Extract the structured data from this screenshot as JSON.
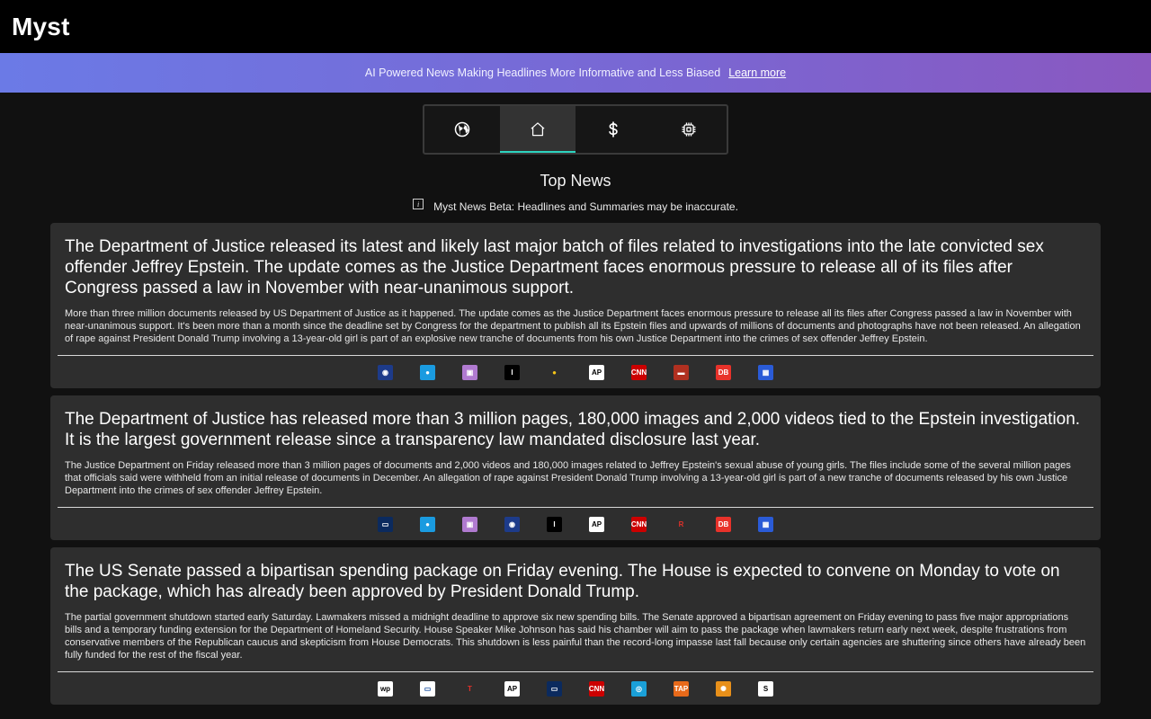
{
  "app": {
    "title": "Myst"
  },
  "banner": {
    "text": "AI Powered News Making Headlines More Informative and Less Biased",
    "link": "Learn more"
  },
  "tabs": [
    {
      "icon": "globe-icon",
      "active": false
    },
    {
      "icon": "home-icon",
      "active": true
    },
    {
      "icon": "dollar-icon",
      "active": false
    },
    {
      "icon": "chip-icon",
      "active": false
    }
  ],
  "section": {
    "title": "Top News",
    "beta_note": "Myst News Beta: Headlines and Summaries may be inaccurate."
  },
  "articles": [
    {
      "headline": "The Department of Justice released its latest and likely last major batch of files related to investigations into the late convicted sex offender Jeffrey Epstein. The update comes as the Justice Department faces enormous pressure to release all of its files after Congress passed a law in November with near-unanimous support.",
      "summary": "More than three million documents released by US Department of Justice as it happened. The update comes as the Justice Department faces enormous pressure to release all its files after Congress passed a law in November with near-unanimous support. It's been more than a month since the deadline set by Congress for the department to publish all its Epstein files and upwards of millions of documents and photographs have not been released. An allegation of rape against President Donald Trump involving a 13-year-old girl is part of an explosive new tranche of documents from his own Justice Department into the crimes of sex offender Jeffrey Epstein.",
      "sources": [
        {
          "name": "source-logo-1",
          "glyph": "◉",
          "bg": "#1d3b8a",
          "fg": "#ffffff"
        },
        {
          "name": "source-logo-2",
          "glyph": "●",
          "bg": "#1a9be0",
          "fg": "#ffffff"
        },
        {
          "name": "source-logo-3",
          "glyph": "▣",
          "bg": "#b07ad0",
          "fg": "#ffffff"
        },
        {
          "name": "source-logo-4",
          "glyph": "I",
          "bg": "#000000",
          "fg": "#ffffff"
        },
        {
          "name": "source-logo-5",
          "glyph": "●",
          "bg": "#2e2e2e",
          "fg": "#f5c518"
        },
        {
          "name": "source-logo-6",
          "glyph": "AP",
          "bg": "#ffffff",
          "fg": "#000000"
        },
        {
          "name": "source-logo-7",
          "glyph": "CNN",
          "bg": "#cc0000",
          "fg": "#ffffff"
        },
        {
          "name": "source-logo-8",
          "glyph": "▬",
          "bg": "#b03020",
          "fg": "#ffffff"
        },
        {
          "name": "source-logo-9",
          "glyph": "DB",
          "bg": "#e8322a",
          "fg": "#ffffff"
        },
        {
          "name": "source-logo-10",
          "glyph": "▦",
          "bg": "#2a5bd7",
          "fg": "#ffffff"
        }
      ]
    },
    {
      "headline": "The Department of Justice has released more than 3 million pages, 180,000 images and 2,000 videos tied to the Epstein investigation. It is the largest government release since a transparency law mandated disclosure last year.",
      "summary": "The Justice Department on Friday released more than 3 million pages of documents and 2,000 videos and 180,000 images related to Jeffrey Epstein's sexual abuse of young girls. The files include some of the several million pages that officials said were withheld from an initial release of documents in December. An allegation of rape against President Donald Trump involving a 13-year-old girl is part of a new tranche of documents released by his own Justice Department into the crimes of sex offender Jeffrey Epstein.",
      "sources": [
        {
          "name": "source-logo-1",
          "glyph": "▭",
          "bg": "#0b2a5e",
          "fg": "#ffffff"
        },
        {
          "name": "source-logo-2",
          "glyph": "●",
          "bg": "#1a9be0",
          "fg": "#ffffff"
        },
        {
          "name": "source-logo-3",
          "glyph": "▣",
          "bg": "#b07ad0",
          "fg": "#ffffff"
        },
        {
          "name": "source-logo-4",
          "glyph": "◉",
          "bg": "#1d3b8a",
          "fg": "#ffffff"
        },
        {
          "name": "source-logo-5",
          "glyph": "I",
          "bg": "#000000",
          "fg": "#ffffff"
        },
        {
          "name": "source-logo-6",
          "glyph": "AP",
          "bg": "#ffffff",
          "fg": "#000000"
        },
        {
          "name": "source-logo-7",
          "glyph": "CNN",
          "bg": "#cc0000",
          "fg": "#ffffff"
        },
        {
          "name": "source-logo-8",
          "glyph": "R",
          "bg": "#2e2e2e",
          "fg": "#e0302a"
        },
        {
          "name": "source-logo-9",
          "glyph": "DB",
          "bg": "#e8322a",
          "fg": "#ffffff"
        },
        {
          "name": "source-logo-10",
          "glyph": "▦",
          "bg": "#2a5bd7",
          "fg": "#ffffff"
        }
      ]
    },
    {
      "headline": "The US Senate passed a bipartisan spending package on Friday evening. The House is expected to convene on Monday to vote on the package, which has already been approved by President Donald Trump.",
      "summary": "The partial government shutdown started early Saturday. Lawmakers missed a midnight deadline to approve six new spending bills. The Senate approved a bipartisan agreement on Friday evening to pass five major appropriations bills and a temporary funding extension for the Department of Homeland Security. House Speaker Mike Johnson has said his chamber will aim to pass the package when lawmakers return early next week, despite frustrations from conservative members of the Republican caucus and skepticism from House Democrats. This shutdown is less painful than the record-long impasse last fall because only certain agencies are shuttering since others have already been fully funded for the rest of the fiscal year.",
      "sources": [
        {
          "name": "source-logo-1",
          "glyph": "wp",
          "bg": "#ffffff",
          "fg": "#000000"
        },
        {
          "name": "source-logo-2",
          "glyph": "▭",
          "bg": "#ffffff",
          "fg": "#1a4fa0"
        },
        {
          "name": "source-logo-3",
          "glyph": "T",
          "bg": "#2e2e2e",
          "fg": "#e0302a"
        },
        {
          "name": "source-logo-4",
          "glyph": "AP",
          "bg": "#ffffff",
          "fg": "#000000"
        },
        {
          "name": "source-logo-5",
          "glyph": "▭",
          "bg": "#0b2a5e",
          "fg": "#ffffff"
        },
        {
          "name": "source-logo-6",
          "glyph": "CNN",
          "bg": "#cc0000",
          "fg": "#ffffff"
        },
        {
          "name": "source-logo-7",
          "glyph": "◎",
          "bg": "#1aa0d8",
          "fg": "#ffffff"
        },
        {
          "name": "source-logo-8",
          "glyph": "TAP",
          "bg": "#e86a1a",
          "fg": "#ffffff"
        },
        {
          "name": "source-logo-9",
          "glyph": "✺",
          "bg": "#e8901a",
          "fg": "#ffffff"
        },
        {
          "name": "source-logo-10",
          "glyph": "S",
          "bg": "#ffffff",
          "fg": "#000000"
        }
      ]
    }
  ]
}
